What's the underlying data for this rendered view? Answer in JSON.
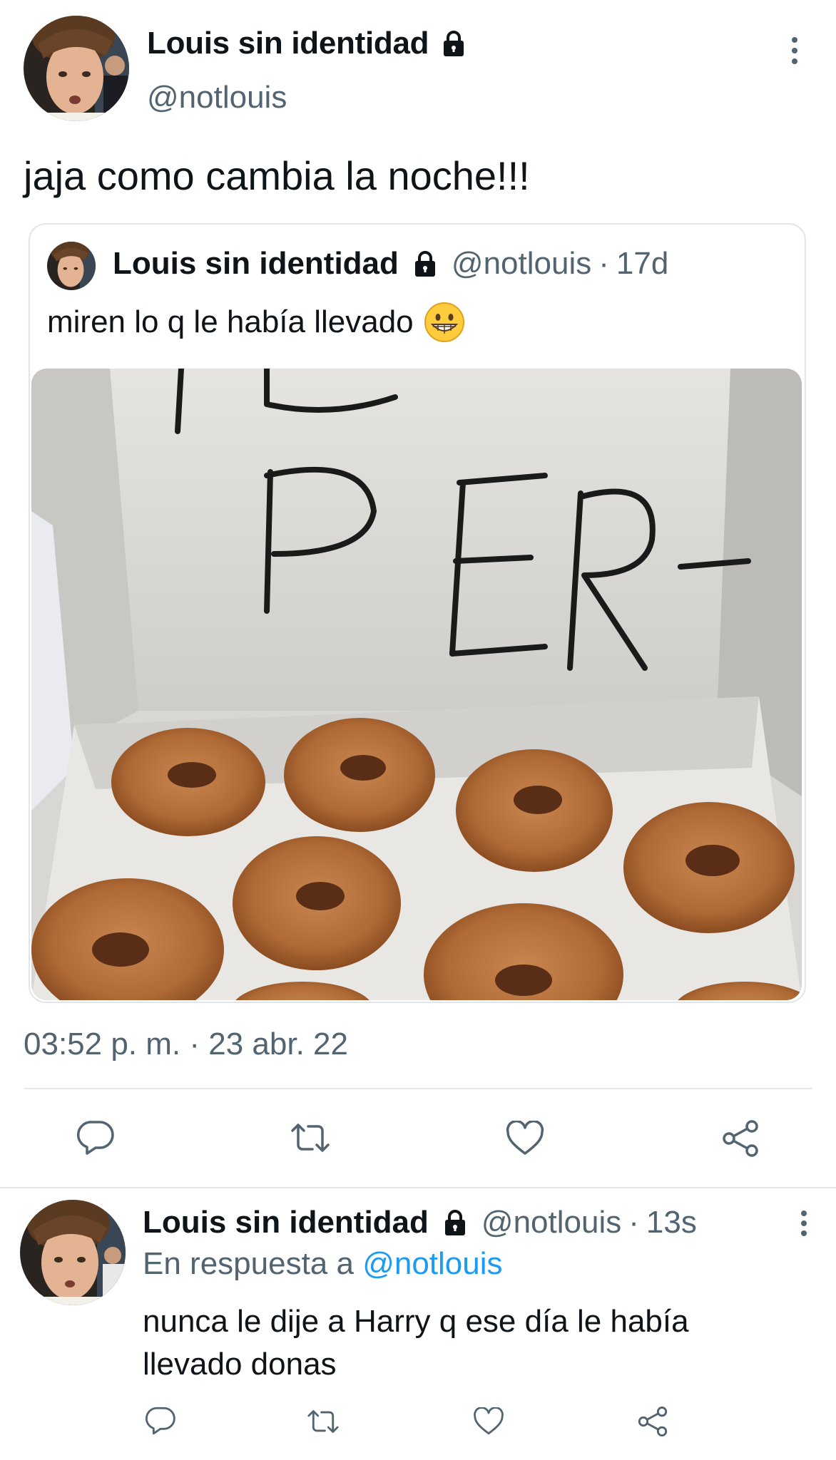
{
  "main_tweet": {
    "display_name": "Louis sin identidad",
    "handle": "@notlouis",
    "text": "jaja como cambia la noche!!!",
    "timestamp": "03:52 p. m. · 23 abr. 22",
    "icons": {
      "verified_lock": "lock-icon",
      "more": "more-vertical-icon",
      "reply": "reply-icon",
      "retweet": "retweet-icon",
      "like": "heart-icon",
      "share": "share-icon"
    }
  },
  "quoted_tweet": {
    "display_name": "Louis sin identidad",
    "handle": "@notlouis",
    "separator": "·",
    "relative_time": "17d",
    "text": "miren lo q le había llevado",
    "emoji": "grinning-face-emoji",
    "media": {
      "box_lettering": "PER-",
      "description_icon": "donut-box-photo"
    }
  },
  "reply_tweet": {
    "display_name": "Louis sin identidad",
    "handle": "@notlouis",
    "separator": "·",
    "relative_time": "13s",
    "replying_prefix": "En respuesta a",
    "replying_to": "@notlouis",
    "text": "nunca le dije a Harry q ese día le había llevado donas"
  },
  "colors": {
    "text_primary": "#0f1419",
    "text_secondary": "#536471",
    "accent": "#1d9bf0",
    "divider": "#e6e9eb"
  }
}
